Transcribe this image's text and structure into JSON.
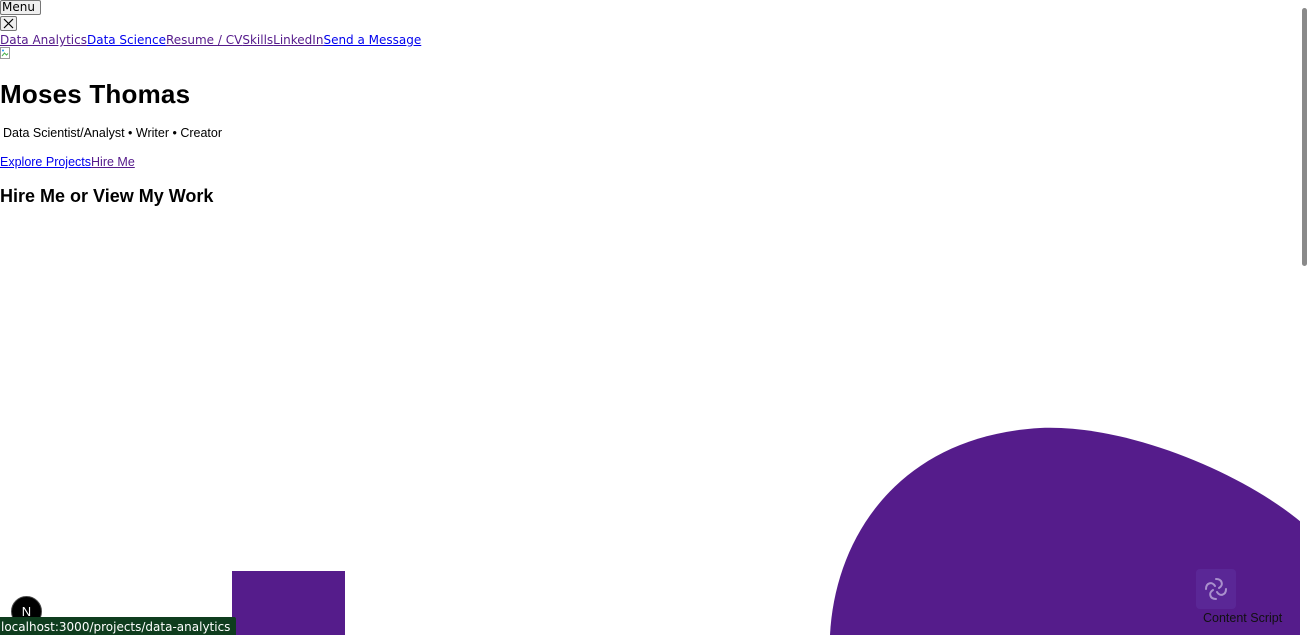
{
  "header": {
    "menu_label": "Menu"
  },
  "nav": {
    "items": [
      {
        "label": "Data Analytics",
        "visited": true
      },
      {
        "label": "Data Science",
        "visited": false
      },
      {
        "label": "Resume / CV",
        "visited": true
      },
      {
        "label": "Skills",
        "visited": true
      },
      {
        "label": "LinkedIn",
        "visited": true
      },
      {
        "label": "Send a Message",
        "visited": false
      }
    ]
  },
  "hero": {
    "name": "Moses Thomas",
    "tagline": "Data Scientist/Analyst • Writer • Creator",
    "cta_primary": "Explore Projects",
    "cta_secondary": "Hire Me"
  },
  "section": {
    "heading": "Hire Me or View My Work"
  },
  "next_badge": {
    "letter": "N"
  },
  "status_bar": {
    "url": "localhost:3000/projects/data-analytics"
  },
  "extension": {
    "label": "Content Script"
  },
  "colors": {
    "accent_purple": "#551c8b",
    "link": "#0000ee",
    "link_visited": "#551a8b",
    "status_bar_bg": "#0f3d1e"
  }
}
